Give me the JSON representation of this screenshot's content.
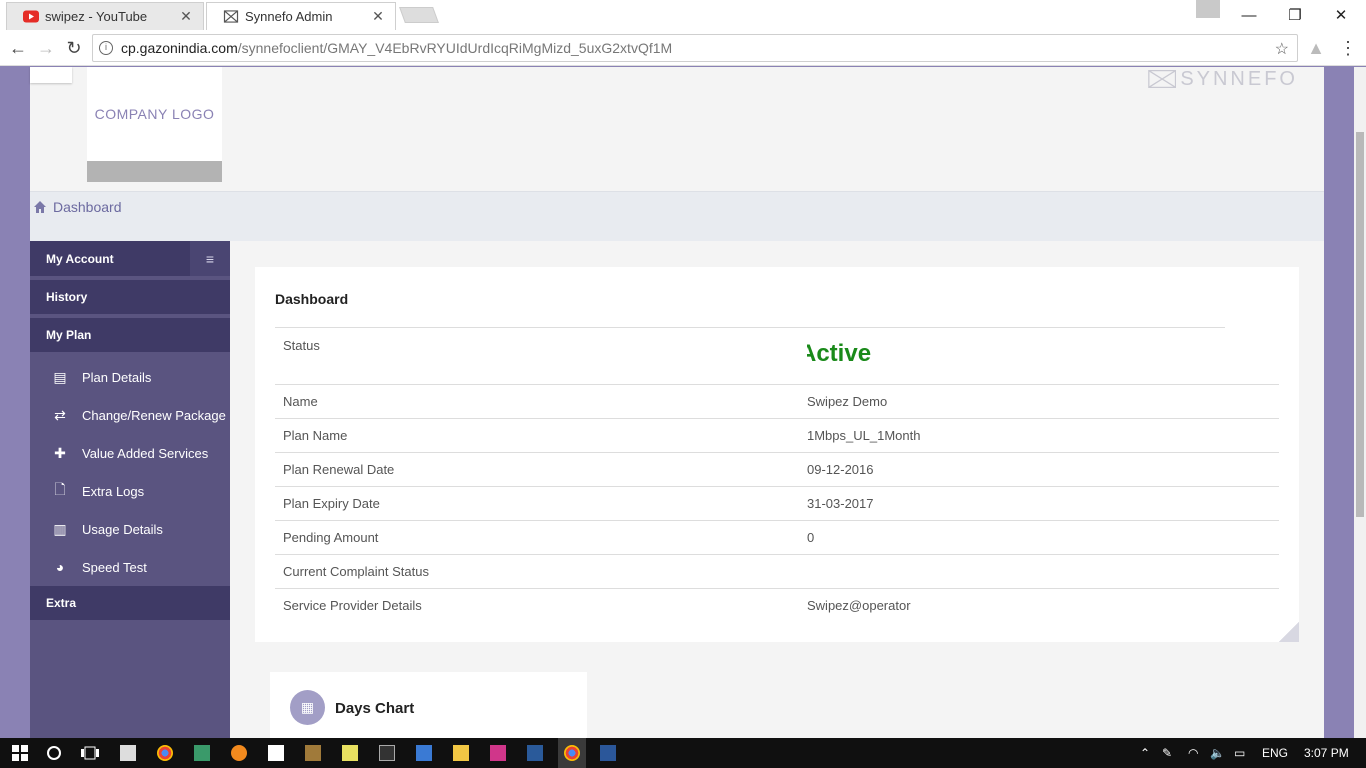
{
  "browser": {
    "tabs": [
      {
        "title": "swipez - YouTube",
        "icon": "youtube-icon"
      },
      {
        "title": "Synnefo Admin",
        "icon": "synnefo-icon"
      }
    ],
    "url_host": "cp.gazonindia.com",
    "url_path": "/synnefoclient/GMAY_V4EbRvRYUIdUrdIcqRiMgMizd_5uxG2xtvQf1M",
    "close_glyph": "✕",
    "minimize_glyph": "—",
    "maximize_glyph": "❐"
  },
  "header": {
    "company_logo": "COMPANY LOGO",
    "brand_name": "SYNNEFO"
  },
  "breadcrumb": {
    "label": "Dashboard"
  },
  "sidebar": {
    "sections": {
      "my_account": "My Account",
      "history": "History",
      "my_plan": "My Plan",
      "extra": "Extra"
    },
    "items": [
      {
        "label": "Plan Details",
        "icon": "document-list-icon"
      },
      {
        "label": "Change/Renew Package",
        "icon": "swap-arrows-icon"
      },
      {
        "label": "Value Added Services",
        "icon": "plus-icon"
      },
      {
        "label": "Extra Logs",
        "icon": "file-icon"
      },
      {
        "label": "Usage Details",
        "icon": "bar-chart-icon"
      },
      {
        "label": "Speed Test",
        "icon": "speedometer-icon"
      }
    ]
  },
  "dashboard": {
    "title": "Dashboard",
    "status_label": "Status",
    "status_value": "Active",
    "rows": [
      {
        "key": "Name",
        "value": "Swipez Demo"
      },
      {
        "key": "Plan Name",
        "value": "1Mbps_UL_1Month"
      },
      {
        "key": "Plan Renewal Date",
        "value": "09-12-2016"
      },
      {
        "key": "Plan Expiry Date",
        "value": "31-03-2017"
      },
      {
        "key": "Pending Amount",
        "value": "0"
      },
      {
        "key": "Current Complaint Status",
        "value": ""
      },
      {
        "key": "Service Provider Details",
        "value": "Swipez@operator"
      }
    ]
  },
  "days_chart": {
    "title": "Days Chart"
  },
  "taskbar": {
    "language": "ENG",
    "time": "3:07 PM"
  },
  "colors": {
    "sidebar_bg": "#5a5480",
    "sidebar_head": "#3f3a66",
    "page_bg": "#8a82b4",
    "status_active": "#1a8a1a"
  }
}
